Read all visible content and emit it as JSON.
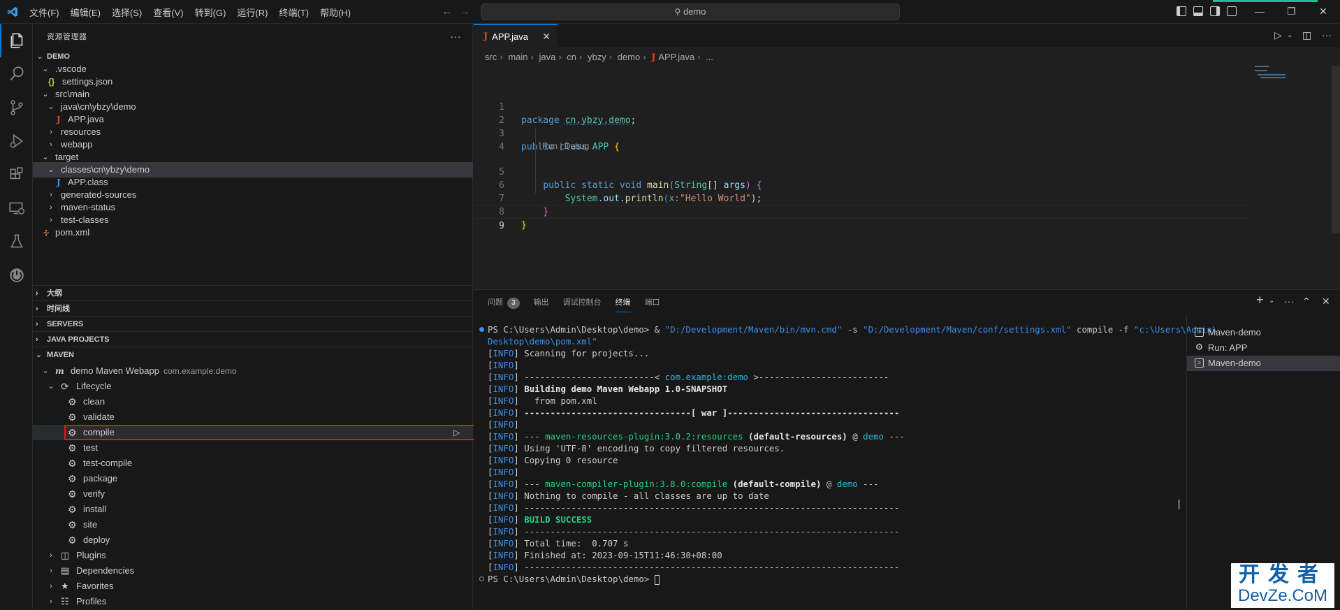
{
  "titlebar": {
    "menu": [
      "文件(F)",
      "编辑(E)",
      "选择(S)",
      "查看(V)",
      "转到(G)",
      "运行(R)",
      "终端(T)",
      "帮助(H)"
    ],
    "search_text": "demo"
  },
  "activity": [
    "explorer-icon",
    "search-icon",
    "source-control-icon",
    "run-debug-icon",
    "extensions-icon",
    "remote-explorer-icon",
    "testing-icon",
    "spring-boot-icon"
  ],
  "sidebar": {
    "title": "资源管理器",
    "more": "···",
    "tree": {
      "root": "DEMO",
      "vscode": ".vscode",
      "settings": "settings.json",
      "srcmain": "src\\main",
      "java_path": "java\\cn\\ybzy\\demo",
      "app_java": "APP.java",
      "resources": "resources",
      "webapp": "webapp",
      "target": "target",
      "classes_path": "classes\\cn\\ybzy\\demo",
      "app_class": "APP.class",
      "generated": "generated-sources",
      "maven_status": "maven-status",
      "test_classes": "test-classes",
      "pom": "pom.xml"
    },
    "sections": {
      "outline": "大纲",
      "timeline": "时间线",
      "servers": "SERVERS",
      "java_projects": "JAVA PROJECTS",
      "maven": "MAVEN"
    },
    "maven": {
      "project": "demo Maven Webapp",
      "project_desc": "com.example:demo",
      "lifecycle": "Lifecycle",
      "goals": [
        "clean",
        "validate",
        "compile",
        "test",
        "test-compile",
        "package",
        "verify",
        "install",
        "site",
        "deploy"
      ],
      "plugins": "Plugins",
      "dependencies": "Dependencies",
      "favorites": "Favorites",
      "profiles": "Profiles"
    }
  },
  "editor": {
    "tab_label": "APP.java",
    "breadcrumb": [
      "src",
      "main",
      "java",
      "cn",
      "ybzy",
      "demo",
      "APP.java",
      "..."
    ],
    "codelens": "Run | Debug",
    "line_numbers": [
      "1",
      "2",
      "3",
      "4",
      "",
      "5",
      "6",
      "7",
      "8",
      "9"
    ],
    "code": {
      "l1_kw": "package",
      "l1_pkg": "cn.ybzy.demo",
      "l1_end": ";",
      "l3_kw1": "public",
      "l3_kw2": "class",
      "l3_cls": "APP",
      "l3_brace": "{",
      "l5_kw1": "public",
      "l5_kw2": "static",
      "l5_kw3": "void",
      "l5_fn": "main",
      "l5_paren": "(",
      "l5_type": "String",
      "l5_arr": "[]",
      "l5_arg": "args",
      "l5_close": ")",
      "l5_brace": "{",
      "l6_cls": "System",
      "l6_dot1": ".",
      "l6_out": "out",
      "l6_dot2": ".",
      "l6_fn": "println",
      "l6_open": "(",
      "l6_hint": "x:",
      "l6_str": "\"Hello World\"",
      "l6_close": ");",
      "l7_brace": "}",
      "l8_brace": "}"
    }
  },
  "panel": {
    "tabs": [
      "问题",
      "输出",
      "调试控制台",
      "终端",
      "端口"
    ],
    "problems_count": "3",
    "terminal_lines": [
      {
        "type": "cmd",
        "prompt": "PS C:\\Users\\Admin\\Desktop\\demo> ",
        "amp": "& ",
        "exe": "\"D:/Development/Maven/bin/mvn.cmd\"",
        "flag1": " -s ",
        "settings": "\"D:/Development/Maven/conf/settings.xml\"",
        "goal": " compile -f ",
        "pomq": "\"c:\\Users\\Admin\\"
      },
      {
        "type": "cont",
        "text": "Desktop\\demo\\pom.xml\""
      },
      {
        "type": "info",
        "text": "Scanning for projects..."
      },
      {
        "type": "info",
        "text": ""
      },
      {
        "type": "info-art",
        "pre": "-------------------------< ",
        "mid": "com.example:demo",
        "post": " >-------------------------"
      },
      {
        "type": "info-bold",
        "text": "Building demo Maven Webapp 1.0-SNAPSHOT"
      },
      {
        "type": "info",
        "text": "  from pom.xml"
      },
      {
        "type": "info-bold",
        "text": "--------------------------------[ war ]---------------------------------"
      },
      {
        "type": "info",
        "text": ""
      },
      {
        "type": "info-plugin",
        "pre": "--- ",
        "plugin": "maven-resources-plugin:3.0.2:resources",
        "exec": " (default-resources)",
        "at": " @ ",
        "proj": "demo",
        "post": " ---"
      },
      {
        "type": "info",
        "text": "Using 'UTF-8' encoding to copy filtered resources."
      },
      {
        "type": "info",
        "text": "Copying 0 resource"
      },
      {
        "type": "info",
        "text": ""
      },
      {
        "type": "info-plugin",
        "pre": "--- ",
        "plugin": "maven-compiler-plugin:3.8.0:compile",
        "exec": " (default-compile)",
        "at": " @ ",
        "proj": "demo",
        "post": " ---"
      },
      {
        "type": "info",
        "text": "Nothing to compile - all classes are up to date"
      },
      {
        "type": "info",
        "text": "------------------------------------------------------------------------"
      },
      {
        "type": "info-success",
        "text": "BUILD SUCCESS"
      },
      {
        "type": "info",
        "text": "------------------------------------------------------------------------"
      },
      {
        "type": "info",
        "text": "Total time:  0.707 s"
      },
      {
        "type": "info",
        "text": "Finished at: 2023-09-15T11:46:30+08:00"
      },
      {
        "type": "info",
        "text": "------------------------------------------------------------------------"
      },
      {
        "type": "prompt",
        "text": "PS C:\\Users\\Admin\\Desktop\\demo> "
      }
    ],
    "info_tag": "INFO",
    "terminals": [
      "Maven-demo",
      "Run: APP",
      "Maven-demo"
    ]
  },
  "watermark": {
    "line1": "开发者",
    "line2": "DevZe.CoM"
  },
  "colors": {
    "accent": "#0078d4",
    "highlight": "#e81123",
    "info": "#3b8eea",
    "success": "#23d18b"
  }
}
